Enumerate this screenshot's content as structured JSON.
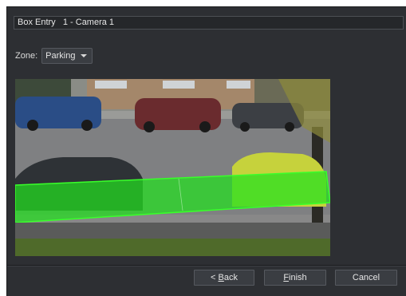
{
  "window": {
    "title": "Box Entry   1 - Camera 1"
  },
  "zone": {
    "label": "Zone:",
    "selected": "Parking"
  },
  "preview": {
    "zone_overlay_color": "#22e01e",
    "description_icon": "camera-frame"
  },
  "buttons": {
    "back": {
      "prefix": "< ",
      "accel": "B",
      "rest": "ack"
    },
    "finish": {
      "accel": "F",
      "rest": "inish"
    },
    "cancel": "Cancel"
  },
  "colors": {
    "dialog_bg": "#2d2f33",
    "button_bg": "#3a3d42",
    "zone_green": "#22e01e"
  }
}
